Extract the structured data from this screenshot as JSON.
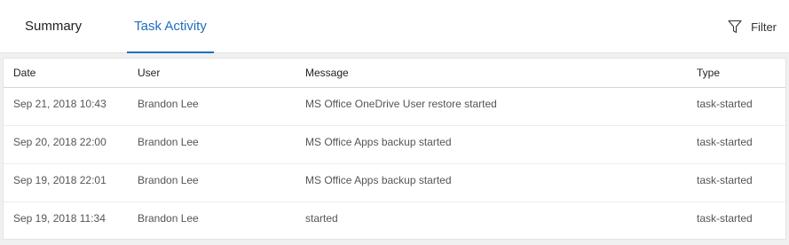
{
  "tabs": [
    {
      "label": "Summary",
      "active": false
    },
    {
      "label": "Task Activity",
      "active": true
    }
  ],
  "filter": {
    "label": "Filter",
    "icon": "filter-icon"
  },
  "colors": {
    "accent": "#1f6fc0"
  },
  "table": {
    "columns": [
      "Date",
      "User",
      "Message",
      "Type"
    ],
    "rows": [
      {
        "date": "Sep 21, 2018 10:43",
        "user": "Brandon Lee",
        "message": "MS Office OneDrive User restore started",
        "type": "task-started"
      },
      {
        "date": "Sep 20, 2018 22:00",
        "user": "Brandon Lee",
        "message": "MS Office Apps backup started",
        "type": "task-started"
      },
      {
        "date": "Sep 19, 2018 22:01",
        "user": "Brandon Lee",
        "message": "MS Office Apps backup started",
        "type": "task-started"
      },
      {
        "date": "Sep 19, 2018 11:34",
        "user": "Brandon Lee",
        "message": "started",
        "type": "task-started"
      }
    ]
  }
}
